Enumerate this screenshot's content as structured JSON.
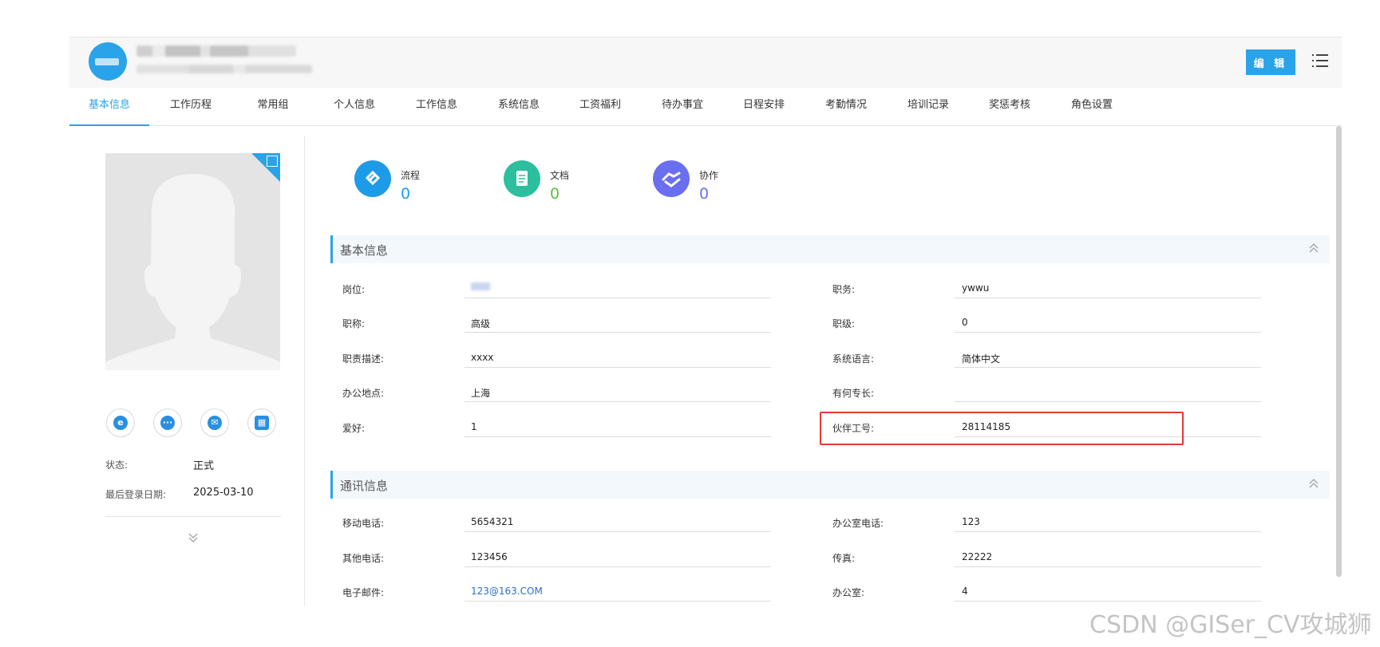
{
  "header": {
    "edit_label": "编 辑"
  },
  "tabs": [
    "基本信息",
    "工作历程",
    "常用组",
    "个人信息",
    "工作信息",
    "系统信息",
    "工资福利",
    "待办事宜",
    "日程安排",
    "考勤情况",
    "培训记录",
    "奖惩考核",
    "角色设置"
  ],
  "left": {
    "status_label": "状态:",
    "status_value": "正式",
    "last_login_label": "最后登录日期:",
    "last_login_value": "2025-03-10",
    "contact_icons": [
      "e-icon",
      "chat-icon",
      "mail-icon",
      "calendar-icon"
    ]
  },
  "stats": [
    {
      "label": "流程",
      "value": "0",
      "color": "#1e9be8"
    },
    {
      "label": "文档",
      "value": "0",
      "color": "#2bbf9e"
    },
    {
      "label": "协作",
      "value": "0",
      "color": "#6a6ff0"
    }
  ],
  "basic": {
    "title": "基本信息",
    "rows": [
      {
        "l1": "岗位:",
        "v1": "",
        "l2": "职务:",
        "v2": "ywwu"
      },
      {
        "l1": "职称:",
        "v1": "高级",
        "l2": "职级:",
        "v2": "0"
      },
      {
        "l1": "职责描述:",
        "v1": "xxxx",
        "l2": "系统语言:",
        "v2": "简体中文"
      },
      {
        "l1": "办公地点:",
        "v1": "上海",
        "l2": "有何专长:",
        "v2": ""
      },
      {
        "l1": "爱好:",
        "v1": "1",
        "l2": "伙伴工号:",
        "v2": "28114185"
      }
    ]
  },
  "comm": {
    "title": "通讯信息",
    "rows": [
      {
        "l1": "移动电话:",
        "v1": "5654321",
        "l2": "办公室电话:",
        "v2": "123"
      },
      {
        "l1": "其他电话:",
        "v1": "123456",
        "l2": "传真:",
        "v2": "22222"
      },
      {
        "l1": "电子邮件:",
        "v1": "123@163.COM",
        "l2": "办公室:",
        "v2": "4"
      }
    ]
  },
  "watermark": "CSDN @GISer_CV攻城狮"
}
